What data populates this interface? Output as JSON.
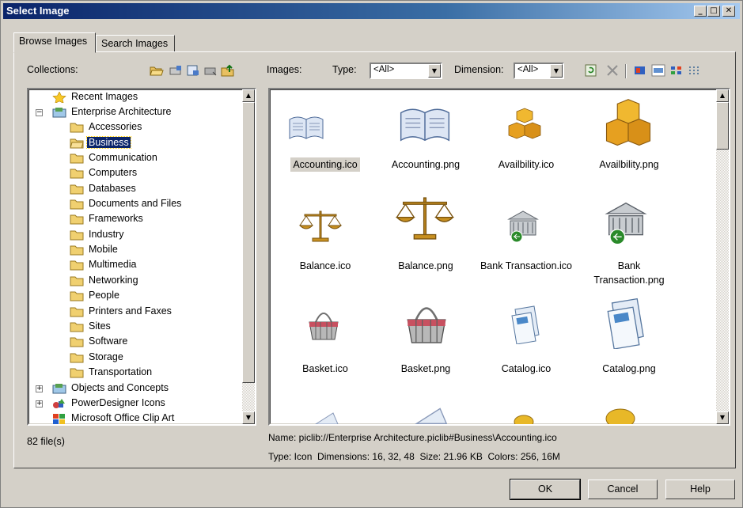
{
  "window": {
    "title": "Select Image",
    "min": "_",
    "max": "□",
    "close": "✕"
  },
  "tabs": [
    {
      "label": "Browse Images"
    },
    {
      "label": "Search Images"
    }
  ],
  "collections_label": "Collections:",
  "images_label": "Images:",
  "type_label": "Type:",
  "type_value": "<All>",
  "dimension_label": "Dimension:",
  "dimension_value": "<All>",
  "tree": [
    {
      "label": "Recent Images"
    },
    {
      "label": "Enterprise Architecture"
    },
    {
      "label": "Accessories"
    },
    {
      "label": "Business"
    },
    {
      "label": "Communication"
    },
    {
      "label": "Computers"
    },
    {
      "label": "Databases"
    },
    {
      "label": "Documents and Files"
    },
    {
      "label": "Frameworks"
    },
    {
      "label": "Industry"
    },
    {
      "label": "Mobile"
    },
    {
      "label": "Multimedia"
    },
    {
      "label": "Networking"
    },
    {
      "label": "People"
    },
    {
      "label": "Printers and Faxes"
    },
    {
      "label": "Sites"
    },
    {
      "label": "Software"
    },
    {
      "label": "Storage"
    },
    {
      "label": "Transportation"
    },
    {
      "label": "Objects and Concepts"
    },
    {
      "label": "PowerDesigner Icons"
    },
    {
      "label": "Microsoft Office Clip Art"
    }
  ],
  "files": [
    {
      "label": "Accounting.ico",
      "icon": "book-icon"
    },
    {
      "label": "Accounting.png",
      "icon": "book-icon"
    },
    {
      "label": "Availbility.ico",
      "icon": "boxes-icon"
    },
    {
      "label": "Availbility.png",
      "icon": "boxes-icon"
    },
    {
      "label": "Balance.ico",
      "icon": "scales-icon"
    },
    {
      "label": "Balance.png",
      "icon": "scales-icon"
    },
    {
      "label": "Bank Transaction.ico",
      "icon": "bank-icon"
    },
    {
      "label": "Bank",
      "label2": "Transaction.png",
      "icon": "bank-icon"
    },
    {
      "label": "Basket.ico",
      "icon": "basket-icon"
    },
    {
      "label": "Basket.png",
      "icon": "basket-icon"
    },
    {
      "label": "Catalog.ico",
      "icon": "catalog-icon"
    },
    {
      "label": "Catalog.png",
      "icon": "catalog-icon"
    }
  ],
  "file_count": "82 file(s)",
  "name_line": "Name: piclib://Enterprise Architecture.piclib#Business\\Accounting.ico",
  "type_line": "Type: Icon  Dimensions: 16, 32, 48  Size: 21.96 KB  Colors: 256, 16M",
  "buttons": {
    "ok": "OK",
    "cancel": "Cancel",
    "help": "Help"
  }
}
